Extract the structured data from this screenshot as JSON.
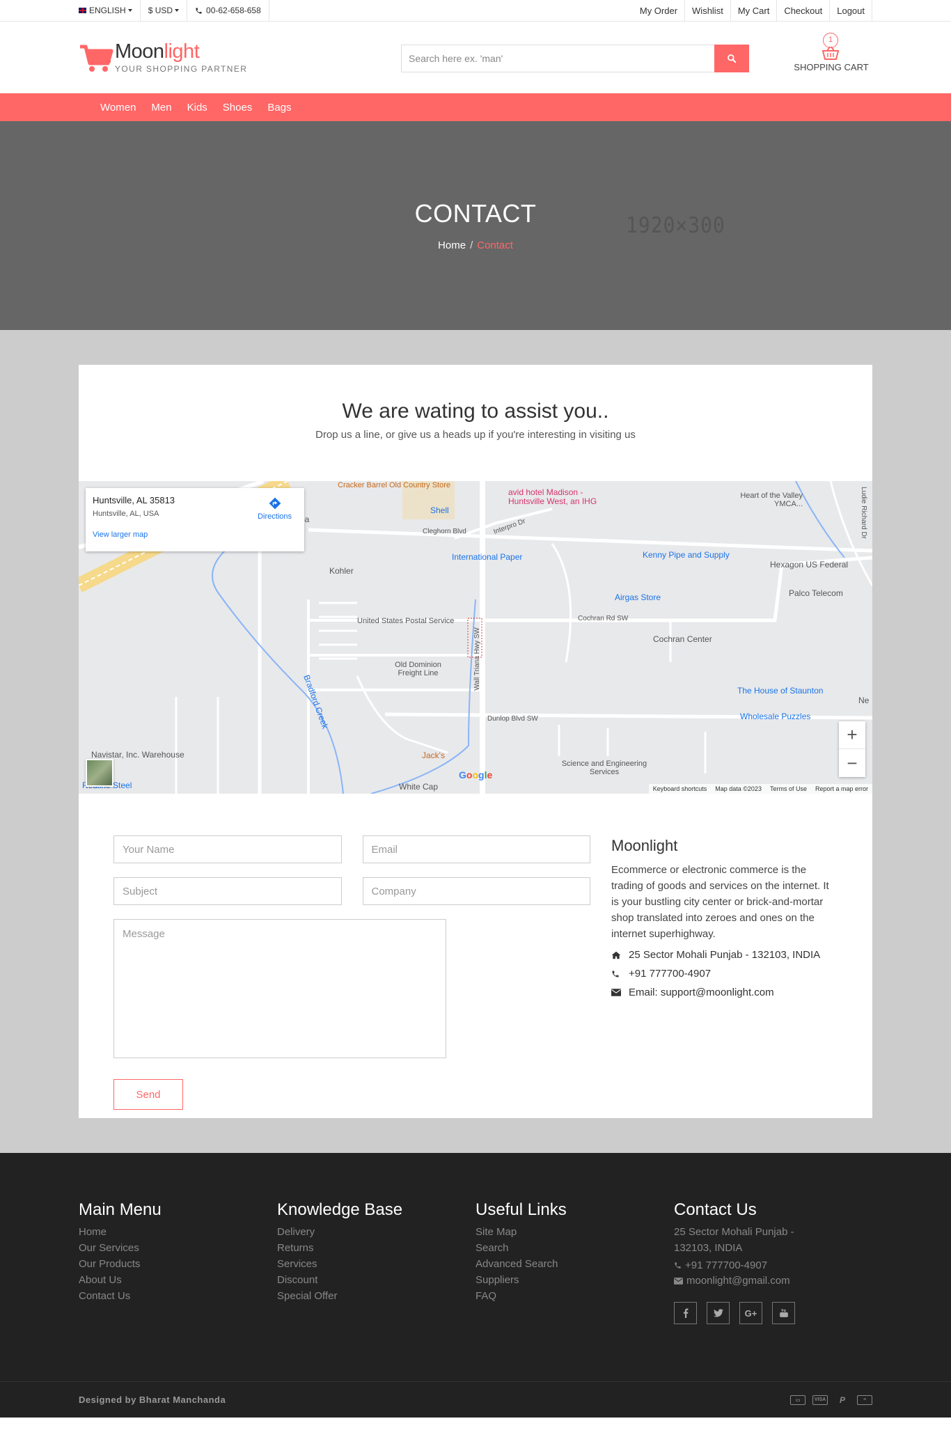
{
  "topbar": {
    "language": "ENGLISH",
    "currency": "$ USD",
    "phone": "00-62-658-658",
    "links": [
      "My Order",
      "Wishlist",
      "My Cart",
      "Checkout",
      "Logout"
    ]
  },
  "header": {
    "brand_dark": "Moon",
    "brand_light": "light",
    "tagline": "YOUR SHOPPING PARTNER",
    "search_placeholder": "Search here ex. 'man'",
    "cart_count": "1",
    "cart_label": "SHOPPING CART"
  },
  "nav": [
    "Women",
    "Men",
    "Kids",
    "Shoes",
    "Bags"
  ],
  "banner": {
    "title": "CONTACT",
    "crumb_home": "Home",
    "crumb_sep": "/",
    "crumb_current": "Contact",
    "placeholder_dims": "1920×300"
  },
  "intro": {
    "heading": "We are wating to assist you..",
    "sub": "Drop us a line, or give us a heads up if you're interesting in visiting us"
  },
  "map": {
    "place": "Huntsville, AL 35813",
    "place_sub": "Huntsville, AL, USA",
    "directions": "Directions",
    "larger": "View larger map",
    "labels": [
      "Cracker Barrel Old Country Store",
      "avid hotel Madison - Huntsville West, an IHG",
      "Heart of the Valley YMCA...",
      "Shell",
      "Cleghorn Blvd",
      "Interpro Dr",
      "International Paper",
      "Kenny Pipe and Supply",
      "Hexagon US Federal",
      "Kohler",
      "Airgas Store",
      "Palco Telecom",
      "United States Postal Service",
      "Cochran Rd SW",
      "Cochran Center",
      "Old Dominion Freight Line",
      "Wall Triana Hwy SW",
      "The House of Staunton",
      "Dunlop Blvd SW",
      "Wholesale Puzzles",
      "Navistar, Inc. Warehouse",
      "Jack's",
      "Science and Engineering Services",
      "Redline Steel",
      "White Cap",
      "Bradford Creek",
      "Spa",
      "Ludie Richard Dr",
      "Ne"
    ],
    "brand": "Google",
    "footer": [
      "Keyboard shortcuts",
      "Map data ©2023",
      "Terms of Use",
      "Report a map error"
    ]
  },
  "form": {
    "name": "Your Name",
    "email": "Email",
    "subject": "Subject",
    "company": "Company",
    "message": "Message",
    "send": "Send"
  },
  "info": {
    "title": "Moonlight",
    "desc": "Ecommerce or electronic commerce is the trading of goods and services on the internet. It is your bustling city center or brick-and-mortar shop translated into zeroes and ones on the internet superhighway.",
    "address": "25 Sector Mohali Punjab - 132103, INDIA",
    "phone": "+91 777700-4907",
    "email": "Email: support@moonlight.com"
  },
  "footer": {
    "main_menu": {
      "title": "Main Menu",
      "items": [
        "Home",
        "Our Services",
        "Our Products",
        "About Us",
        "Contact Us"
      ]
    },
    "knowledge": {
      "title": "Knowledge Base",
      "items": [
        "Delivery",
        "Returns",
        "Services",
        "Discount",
        "Special Offer"
      ]
    },
    "useful": {
      "title": "Useful Links",
      "items": [
        "Site Map",
        "Search",
        "Advanced Search",
        "Suppliers",
        "FAQ"
      ]
    },
    "contact": {
      "title": "Contact Us",
      "address": "25 Sector Mohali Punjab - 132103, INDIA",
      "phone": "+91 777700-4907",
      "email": "moonlight@gmail.com"
    },
    "credit": "Designed by Bharat Manchanda"
  },
  "colors": {
    "accent": "#ff6666",
    "banner": "#666666",
    "footer": "#222222"
  }
}
